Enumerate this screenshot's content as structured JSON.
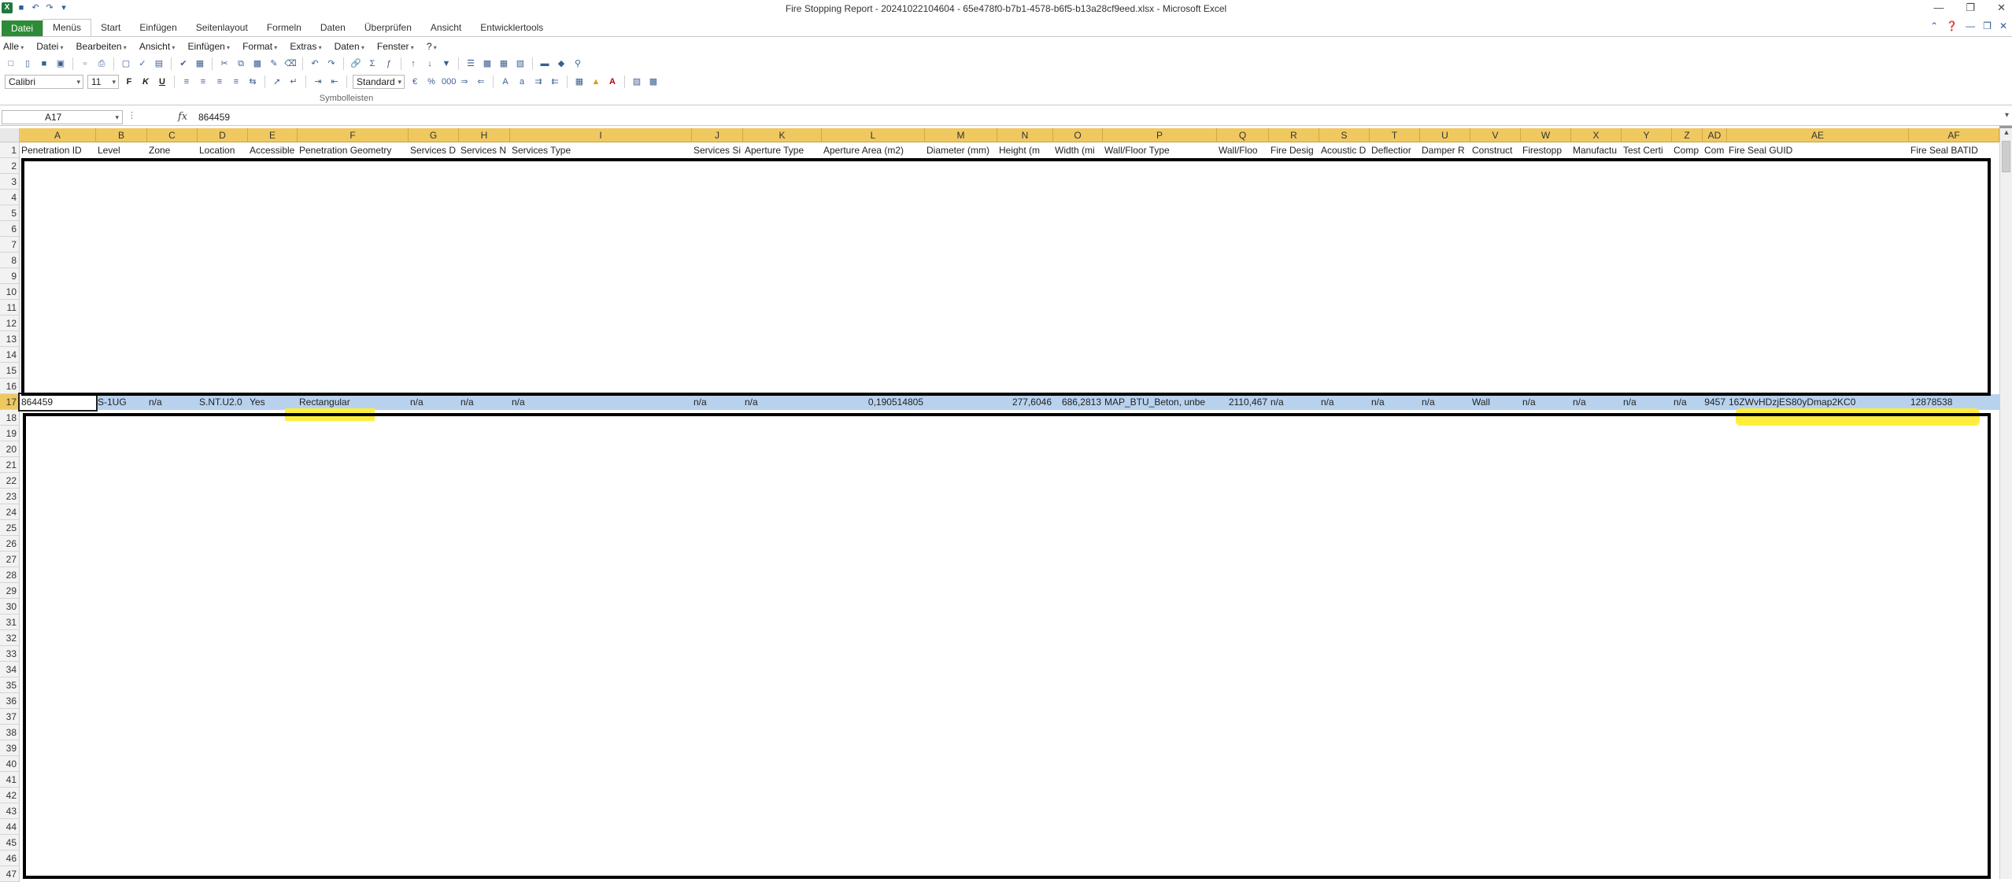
{
  "window": {
    "title": "Fire Stopping Report - 20241022104604 - 65e478f0-b7b1-4578-b6f5-b13a28cf9eed.xlsx  -  Microsoft Excel",
    "quick_access": [
      "excel-logo-icon",
      "save-icon",
      "undo-icon",
      "redo-icon",
      "customize-icon"
    ],
    "controls": [
      "minimize",
      "restore",
      "close"
    ]
  },
  "ribbon": {
    "tabs": [
      "Datei",
      "Menüs",
      "Start",
      "Einfügen",
      "Seitenlayout",
      "Formeln",
      "Daten",
      "Überprüfen",
      "Ansicht",
      "Entwicklertools"
    ],
    "active_tab": "Menüs",
    "menus": [
      "Alle",
      "Datei",
      "Bearbeiten",
      "Ansicht",
      "Einfügen",
      "Format",
      "Extras",
      "Daten",
      "Fenster",
      "?"
    ],
    "font_name": "Calibri",
    "font_size": "11",
    "number_format": "Standard",
    "bold": "F",
    "italic": "K",
    "underline": "U",
    "group_label": "Symbolleisten"
  },
  "formula_bar": {
    "name_box": "A17",
    "fx": "fx",
    "value": "864459"
  },
  "columns": [
    {
      "letter": "A",
      "header": "Penetration ID"
    },
    {
      "letter": "B",
      "header": "Level"
    },
    {
      "letter": "C",
      "header": "Zone"
    },
    {
      "letter": "D",
      "header": "Location"
    },
    {
      "letter": "E",
      "header": "Accessible"
    },
    {
      "letter": "F",
      "header": "Penetration Geometry"
    },
    {
      "letter": "G",
      "header": "Services D"
    },
    {
      "letter": "H",
      "header": "Services N"
    },
    {
      "letter": "I",
      "header": "Services Type"
    },
    {
      "letter": "J",
      "header": "Services Si"
    },
    {
      "letter": "K",
      "header": "Aperture Type"
    },
    {
      "letter": "L",
      "header": "Aperture Area (m2)"
    },
    {
      "letter": "M",
      "header": "Diameter (mm)"
    },
    {
      "letter": "N",
      "header": "Height (m"
    },
    {
      "letter": "O",
      "header": "Width (mi"
    },
    {
      "letter": "P",
      "header": "Wall/Floor Type"
    },
    {
      "letter": "Q",
      "header": "Wall/Floo"
    },
    {
      "letter": "R",
      "header": "Fire Desig"
    },
    {
      "letter": "S",
      "header": "Acoustic D"
    },
    {
      "letter": "T",
      "header": "Deflectior"
    },
    {
      "letter": "U",
      "header": "Damper R"
    },
    {
      "letter": "V",
      "header": "Construct"
    },
    {
      "letter": "W",
      "header": "Firestopp"
    },
    {
      "letter": "X",
      "header": "Manufactu"
    },
    {
      "letter": "Y",
      "header": "Test Certi"
    },
    {
      "letter": "Z",
      "header": "Comp"
    },
    {
      "letter": "AD",
      "header": "Com"
    },
    {
      "letter": "AE",
      "header": "Fire Seal GUID"
    },
    {
      "letter": "AF",
      "header": "Fire Seal BATID"
    }
  ],
  "data_row": {
    "row": "17",
    "cells": [
      "864459",
      "S-1UG",
      "n/a",
      "S.NT.U2.0",
      "Yes",
      "Rectangular",
      "n/a",
      "n/a",
      "n/a",
      "n/a",
      "n/a",
      "0,190514805",
      "",
      "277,6046",
      "686,2813",
      "MAP_BTU_Beton, unbe",
      "2110,467",
      "n/a",
      "n/a",
      "n/a",
      "n/a",
      "Wall",
      "n/a",
      "n/a",
      "n/a",
      "n/a",
      "9457",
      "16ZWvHDzjES80yDmap2KC0",
      "12878538"
    ]
  },
  "row_numbers": [
    "1",
    "2",
    "3",
    "4",
    "5",
    "6",
    "7",
    "8",
    "9",
    "10",
    "11",
    "12",
    "13",
    "14",
    "15",
    "16",
    "17",
    "18",
    "19",
    "20",
    "21",
    "22",
    "23",
    "24",
    "25",
    "26",
    "27",
    "28",
    "29",
    "30",
    "31",
    "32",
    "33",
    "34",
    "35",
    "36",
    "37",
    "38",
    "39",
    "40",
    "41",
    "42",
    "43",
    "44",
    "45",
    "46",
    "47"
  ]
}
